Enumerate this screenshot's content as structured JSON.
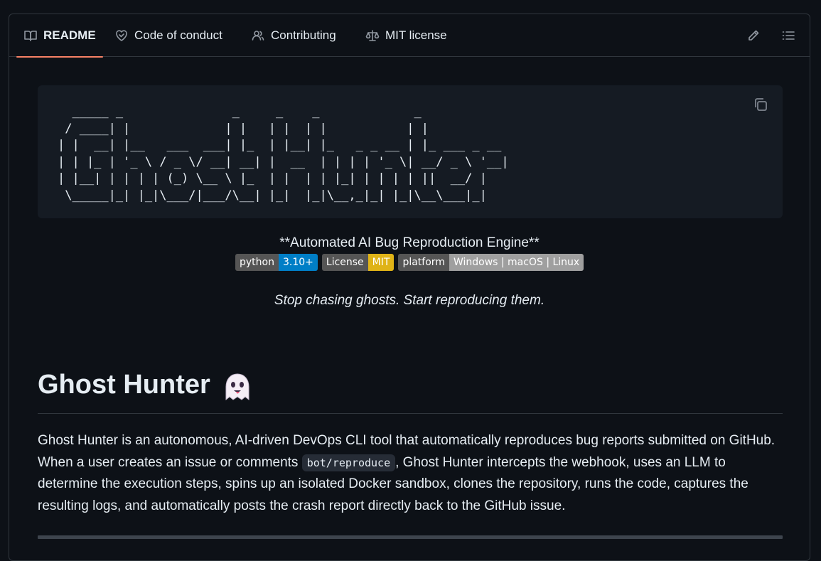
{
  "tabs": [
    {
      "label": "README",
      "icon": "book-icon",
      "active": true
    },
    {
      "label": "Code of conduct",
      "icon": "heart-handshake-icon",
      "active": false
    },
    {
      "label": "Contributing",
      "icon": "people-icon",
      "active": false
    },
    {
      "label": "MIT license",
      "icon": "scale-icon",
      "active": false
    }
  ],
  "toolbar": {
    "edit_icon": "pencil-icon",
    "outline_icon": "list-icon"
  },
  "ascii_art": "  _____ _               _     _    _             _\n / ____| |             | |   | |  | |           | |\n| |  __| |__   ___  ___| |_  | |__| |_   _ _ __ | |_ ___ _ __\n| | |_ | '_ \\ / _ \\/ __| __| |  __  | | | | '_ \\| __/ _ \\ '__|\n| |__| | | | | (_) \\__ \\ |_  | |  | | |_| | | | | ||  __/ |\n \\_____|_| |_|\\___/|___/\\__| |_|  |_|\\__,_|_| |_|\\__\\___|_|",
  "tagline": "**Automated AI Bug Reproduction Engine**",
  "badges": [
    {
      "label": "python",
      "value": "3.10+",
      "color": "#007ec6"
    },
    {
      "label": "License",
      "value": "MIT",
      "color": "#dfb317"
    },
    {
      "label": "platform",
      "value": "Windows | macOS | Linux",
      "color": "#9f9f9f"
    }
  ],
  "slogan": "Stop chasing ghosts. Start reproducing them.",
  "heading": "Ghost Hunter",
  "paragraph": {
    "before_code": "Ghost Hunter is an autonomous, AI-driven DevOps CLI tool that automatically reproduces bug reports submitted on GitHub. When a user creates an issue or comments ",
    "code": "bot/reproduce",
    "after_code": ", Ghost Hunter intercepts the webhook, uses an LLM to determine the execution steps, spins up an isolated Docker sandbox, clones the repository, runs the code, captures the resulting logs, and automatically posts the crash report directly back to the GitHub issue."
  },
  "colors": {
    "active_tab_underline": "#f78166",
    "background": "#0d1117",
    "border": "#30363d"
  }
}
